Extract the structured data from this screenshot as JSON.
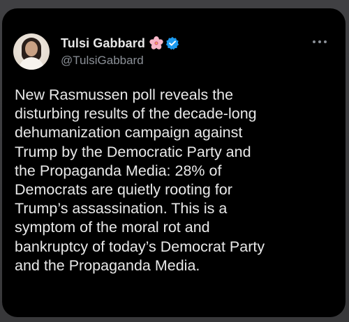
{
  "post": {
    "author": {
      "display_name": "Tulsi Gabbard",
      "handle": "@TulsiGabbard",
      "avatar_icon": "profile-photo",
      "badge_icons": [
        "hibiscus-flower-icon",
        "verified-badge-icon"
      ],
      "verified_color": "#1d9bf0"
    },
    "text": "New Rasmussen poll reveals the\ndisturbing results of the decade-long\ndehumanization campaign against\nTrump by the Democratic Party and\nthe Propaganda Media: 28% of\nDemocrats are quietly rooting for\nTrump’s assassination. This is a\nsymptom of the moral rot and\nbankruptcy of today’s Democrat Party\nand the Propaganda Media.",
    "menu_icon": "more-options-icon"
  },
  "theme": {
    "background": "#000000",
    "text_color": "#e9e9e9",
    "secondary_text_color": "#8b9097"
  }
}
